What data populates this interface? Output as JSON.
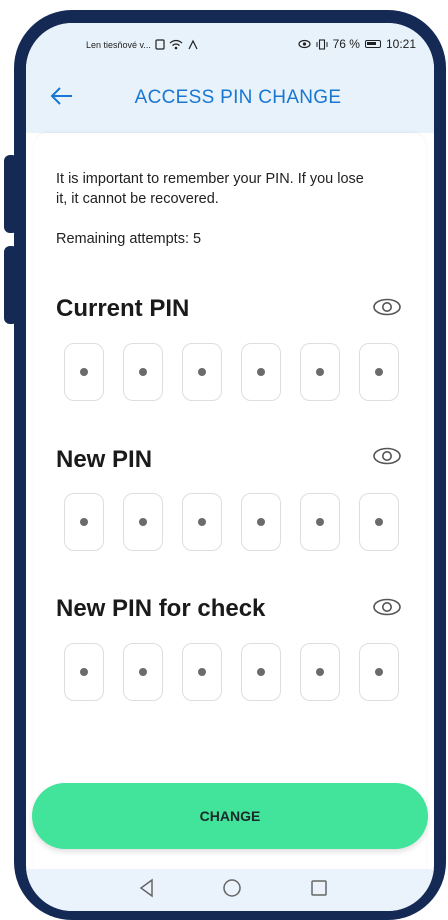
{
  "status_bar": {
    "left_text": "Len tiesňové v...",
    "battery_percent": "76 %",
    "time": "10:21"
  },
  "app_bar": {
    "title": "ACCESS PIN CHANGE"
  },
  "info_text": "It is important to remember your PIN. If you lose it, it cannot be recovered.",
  "remaining_attempts": "Remaining attempts: 5",
  "sections": [
    {
      "title": "Current PIN",
      "digits": 6
    },
    {
      "title": "New PIN",
      "digits": 6
    },
    {
      "title": "New PIN for check",
      "digits": 6
    }
  ],
  "change_button": "CHANGE",
  "colors": {
    "accent": "#1976d2",
    "button": "#42e39a",
    "frame": "#142a55"
  },
  "icons": {
    "back": "arrow-left-icon",
    "toggle_visibility": "eye-icon",
    "nav_back": "triangle-back-icon",
    "nav_home": "circle-home-icon",
    "nav_recent": "square-recent-icon"
  }
}
